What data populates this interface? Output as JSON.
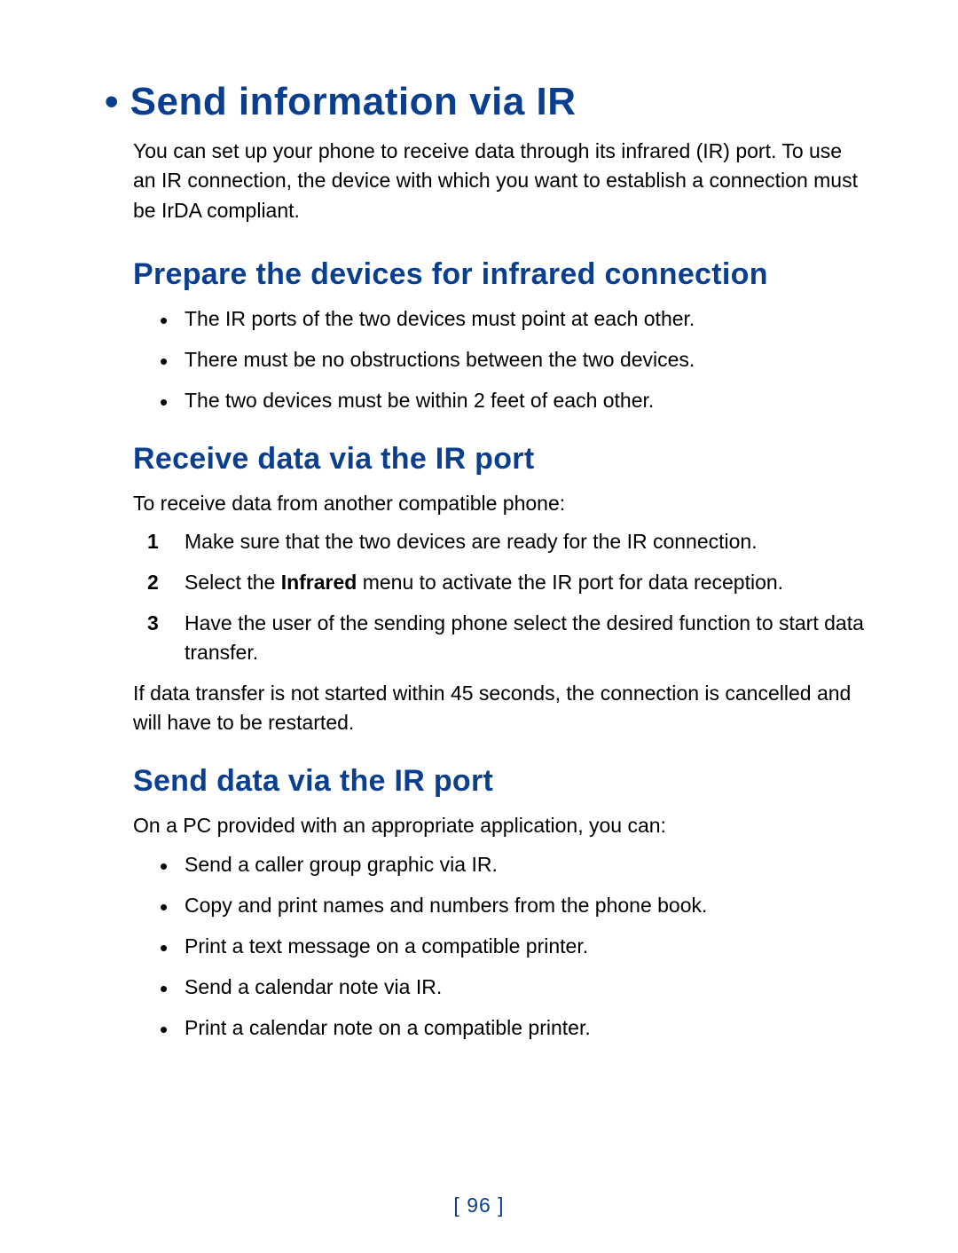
{
  "main_title": "• Send information via IR",
  "intro": "You can set up your phone to receive data through its infrared (IR) port. To use an IR connection, the device with which you want to establish a connection must be IrDA compliant.",
  "sections": {
    "prepare": {
      "title": "Prepare the devices for infrared connection",
      "bullets": [
        "The IR ports of the two devices must point at each other.",
        "There must be no obstructions between the two devices.",
        "The two devices must be within 2 feet of each other."
      ]
    },
    "receive": {
      "title": "Receive data via the IR port",
      "intro": "To receive data from another compatible phone:",
      "steps": [
        {
          "num": "1",
          "text_before": "Make sure that the two devices are ready for the IR connection.",
          "bold": "",
          "text_after": ""
        },
        {
          "num": "2",
          "text_before": "Select the ",
          "bold": "Infrared",
          "text_after": " menu to activate the IR port for data reception."
        },
        {
          "num": "3",
          "text_before": "Have the user of the sending phone select the desired function to start data transfer.",
          "bold": "",
          "text_after": ""
        }
      ],
      "note": "If data transfer is not started within 45 seconds, the connection is cancelled and will have to be restarted."
    },
    "send": {
      "title": "Send data via the IR port",
      "intro": "On a PC provided with an appropriate application, you can:",
      "bullets": [
        "Send a caller group graphic via IR.",
        "Copy and print names and numbers from the phone book.",
        "Print a text message on a compatible printer.",
        "Send a calendar note via IR.",
        "Print a calendar note on a compatible printer."
      ]
    }
  },
  "page_number": "[ 96 ]"
}
